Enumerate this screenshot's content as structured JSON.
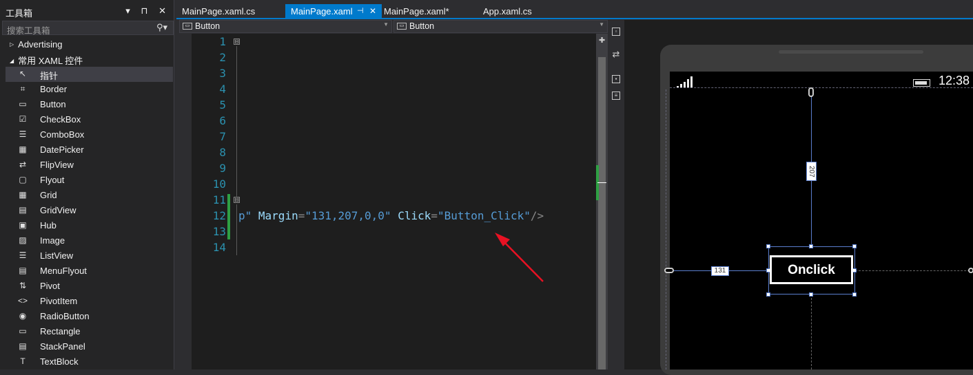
{
  "toolbox": {
    "title": "工具箱",
    "controls": "▾ ⊓ ✕",
    "search_placeholder": "搜索工具箱",
    "categories": [
      {
        "label": "Advertising",
        "expanded": false
      },
      {
        "label": "常用 XAML 控件",
        "expanded": true
      }
    ],
    "items": [
      {
        "label": "指针",
        "icon": "pointer-icon",
        "glyph": "↖"
      },
      {
        "label": "Border",
        "icon": "border-icon",
        "glyph": "⌗"
      },
      {
        "label": "Button",
        "icon": "button-icon",
        "glyph": "▭"
      },
      {
        "label": "CheckBox",
        "icon": "checkbox-icon",
        "glyph": "☑"
      },
      {
        "label": "ComboBox",
        "icon": "combobox-icon",
        "glyph": "☰"
      },
      {
        "label": "DatePicker",
        "icon": "datepicker-icon",
        "glyph": "▦"
      },
      {
        "label": "FlipView",
        "icon": "flipview-icon",
        "glyph": "⇄"
      },
      {
        "label": "Flyout",
        "icon": "flyout-icon",
        "glyph": "▢"
      },
      {
        "label": "Grid",
        "icon": "grid-icon",
        "glyph": "▦"
      },
      {
        "label": "GridView",
        "icon": "gridview-icon",
        "glyph": "▤"
      },
      {
        "label": "Hub",
        "icon": "hub-icon",
        "glyph": "▣"
      },
      {
        "label": "Image",
        "icon": "image-icon",
        "glyph": "▨"
      },
      {
        "label": "ListView",
        "icon": "listview-icon",
        "glyph": "☰"
      },
      {
        "label": "MenuFlyout",
        "icon": "menuflyout-icon",
        "glyph": "▤"
      },
      {
        "label": "Pivot",
        "icon": "pivot-icon",
        "glyph": "⇅"
      },
      {
        "label": "PivotItem",
        "icon": "pivotitem-icon",
        "glyph": "<>"
      },
      {
        "label": "RadioButton",
        "icon": "radiobutton-icon",
        "glyph": "◉"
      },
      {
        "label": "Rectangle",
        "icon": "rectangle-icon",
        "glyph": "▭"
      },
      {
        "label": "StackPanel",
        "icon": "stackpanel-icon",
        "glyph": "▤"
      },
      {
        "label": "TextBlock",
        "icon": "textblock-icon",
        "glyph": "T"
      }
    ]
  },
  "tabs": [
    {
      "label": "MainPage.xaml.cs",
      "active": false
    },
    {
      "label": "MainPage.xaml",
      "active": true,
      "pin": "⊣",
      "close": "✕"
    },
    {
      "label": "MainPage.xaml*",
      "active": false
    },
    {
      "label": "App.xaml.cs",
      "active": false
    }
  ],
  "dropdowns": {
    "left": "Button",
    "right": "Button",
    "icon_glyph": "▭"
  },
  "editor": {
    "line_numbers": [
      "1",
      "2",
      "3",
      "4",
      "5",
      "6",
      "7",
      "8",
      "9",
      "10",
      "11",
      "12",
      "13",
      "14"
    ],
    "fold_glyph": "⊟",
    "line12": {
      "pre": "p\" ",
      "attr1": "Margin",
      "eq1": "=",
      "val1": "\"131,207,0,0\"",
      "sp": " ",
      "attr2": "Click",
      "eq2": "=",
      "val2": "\"Button_Click\"",
      "end": "/>"
    }
  },
  "designer": {
    "clock": "12:38",
    "button_label": "Onclick",
    "margin_top": "207",
    "margin_left": "131"
  },
  "colors": {
    "accent": "#007acc",
    "change_bar": "#2ea043",
    "arrow": "#e81123"
  }
}
